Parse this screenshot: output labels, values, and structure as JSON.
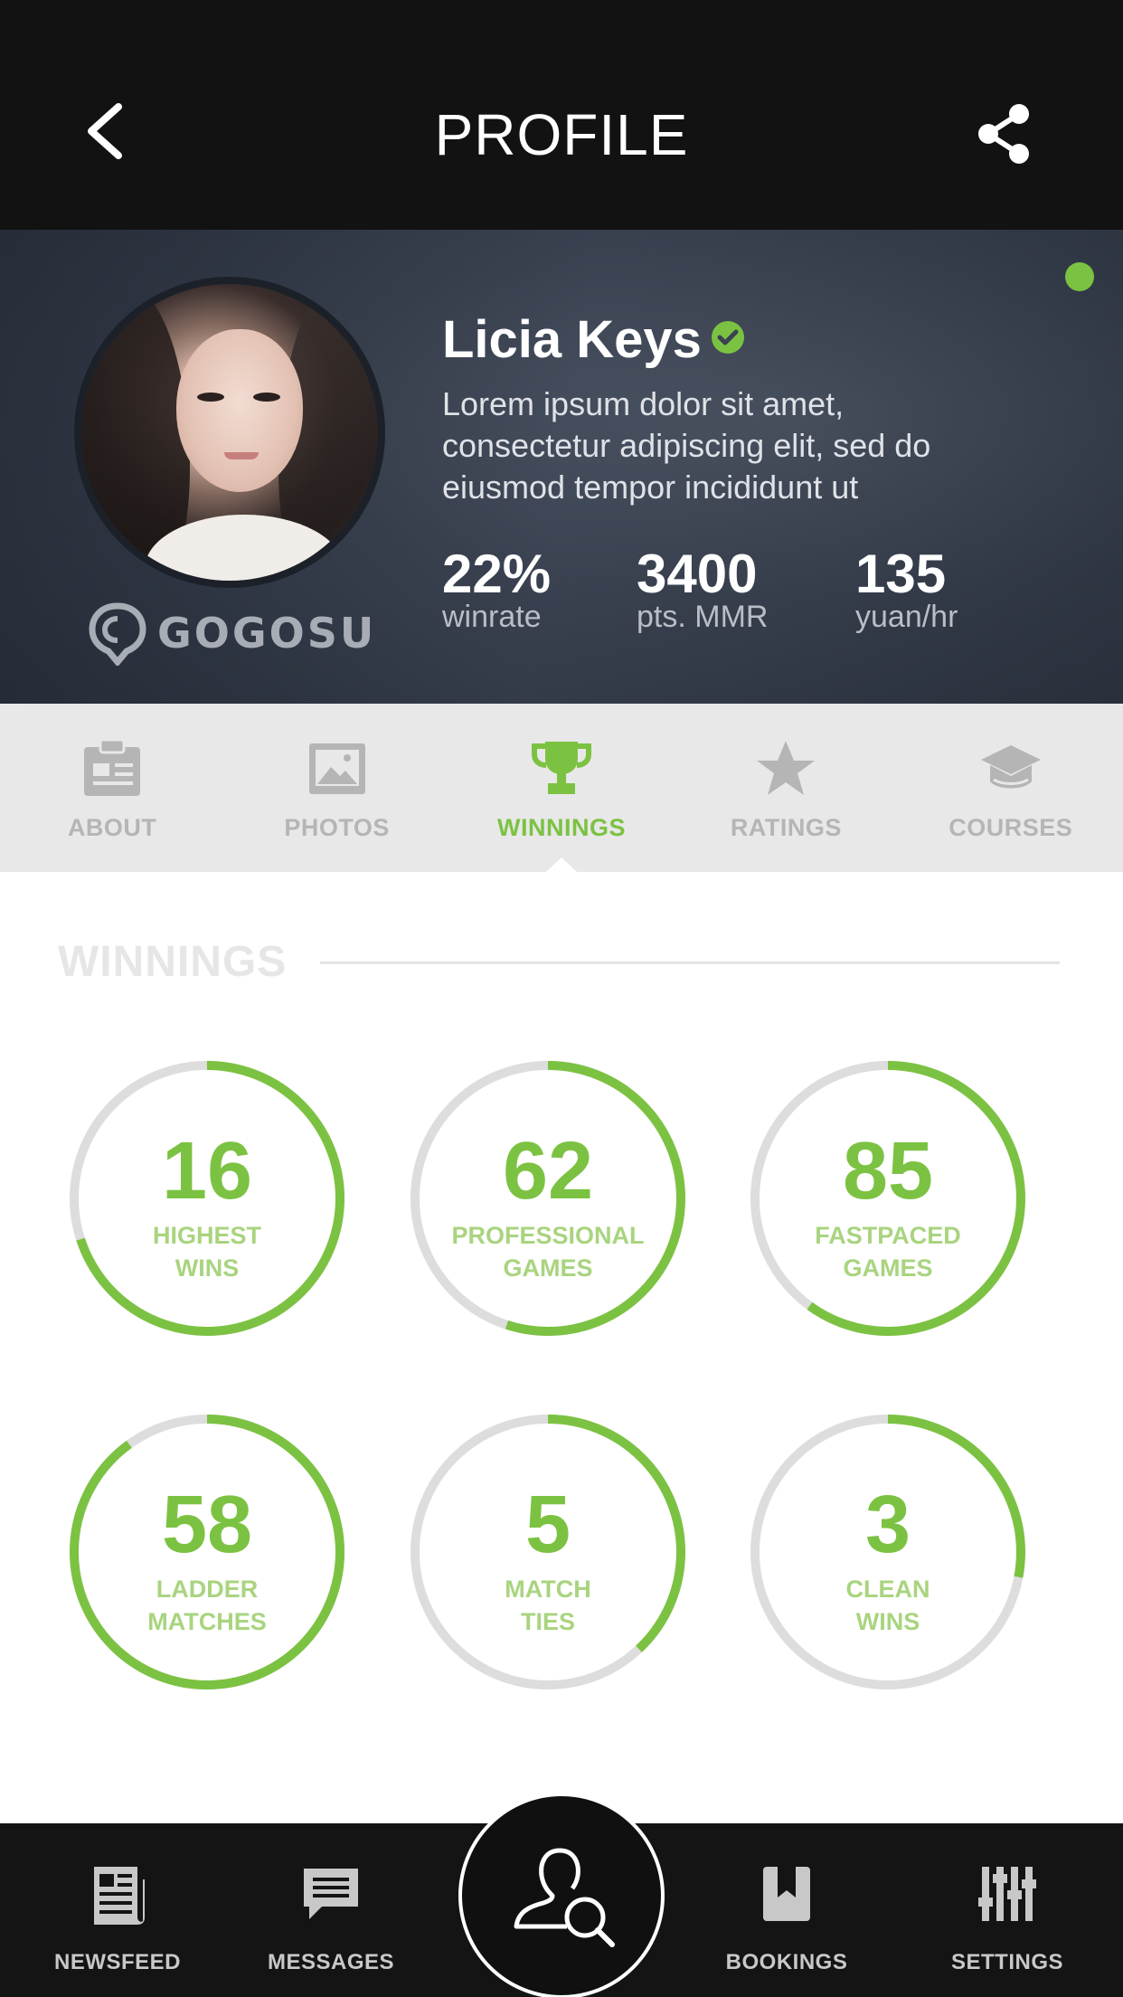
{
  "header": {
    "title": "PROFILE"
  },
  "profile": {
    "name": "Licia Keys",
    "bio": "Lorem ipsum dolor sit amet, consectetur adipiscing elit, sed do eiusmod tempor incididunt ut",
    "brand": "GOGOSU",
    "online": true,
    "stats": [
      {
        "value": "22%",
        "label": "winrate"
      },
      {
        "value": "3400",
        "label": "pts. MMR"
      },
      {
        "value": "135",
        "label": "yuan/hr"
      }
    ]
  },
  "tabs": [
    {
      "label": "ABOUT",
      "icon": "clipboard-icon",
      "active": false
    },
    {
      "label": "PHOTOS",
      "icon": "photo-icon",
      "active": false
    },
    {
      "label": "WINNINGS",
      "icon": "trophy-icon",
      "active": true
    },
    {
      "label": "RATINGS",
      "icon": "star-icon",
      "active": false
    },
    {
      "label": "COURSES",
      "icon": "graduation-cap-icon",
      "active": false
    }
  ],
  "winnings": {
    "title": "WINNINGS",
    "items": [
      {
        "value": "16",
        "caption": "HIGHEST\nWINS",
        "progress": 0.7
      },
      {
        "value": "62",
        "caption": "PROFESSIONAL\nGAMES",
        "progress": 0.55
      },
      {
        "value": "85",
        "caption": "FASTPACED\nGAMES",
        "progress": 0.6
      },
      {
        "value": "58",
        "caption": "LADDER\nMATCHES",
        "progress": 0.9
      },
      {
        "value": "5",
        "caption": "MATCH\nTIES",
        "progress": 0.38
      },
      {
        "value": "3",
        "caption": "CLEAN\nWINS",
        "progress": 0.28
      }
    ]
  },
  "nav": [
    {
      "label": "NEWSFEED",
      "icon": "newspaper-icon"
    },
    {
      "label": "MESSAGES",
      "icon": "chat-icon"
    },
    {
      "label": "",
      "icon": "user-search-icon"
    },
    {
      "label": "BOOKINGS",
      "icon": "bookmark-icon"
    },
    {
      "label": "SETTINGS",
      "icon": "sliders-icon"
    }
  ],
  "colors": {
    "accent": "#7cc242",
    "ring_track": "#dddddd",
    "topbar": "#121212",
    "tabbar": "#e8e8e8",
    "inactive_tab": "#b5b5b5"
  }
}
